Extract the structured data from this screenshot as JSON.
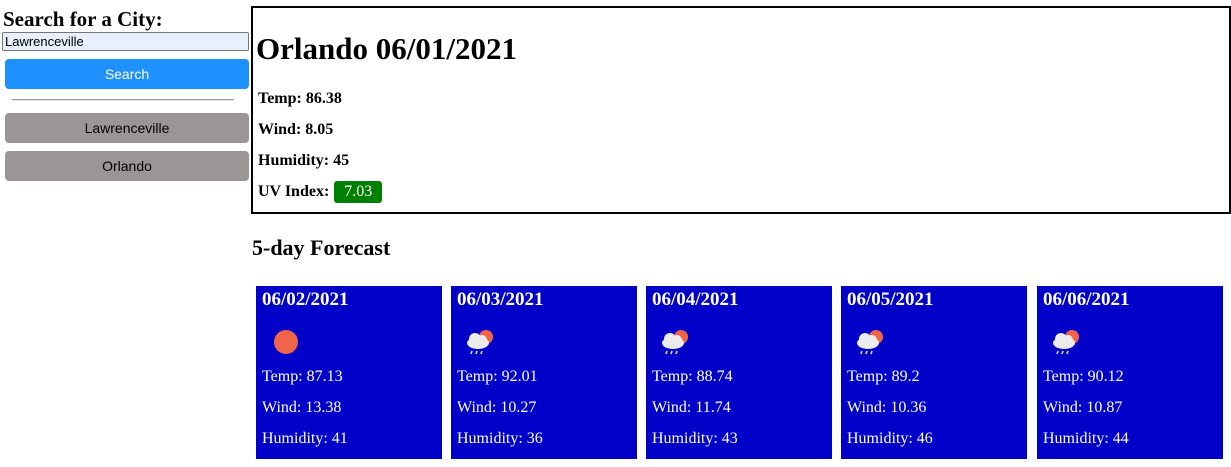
{
  "sidebar": {
    "heading": "Search for a City:",
    "input_value": "Lawrenceville",
    "search_label": "Search",
    "history": [
      "Lawrenceville",
      "Orlando"
    ]
  },
  "current": {
    "title": "Orlando 06/01/2021",
    "temp": "Temp: 86.38",
    "wind": "Wind: 8.05",
    "humidity": "Humidity: 45",
    "uv_label": "UV Index:",
    "uv_value": "7.03",
    "uv_color": "#008000"
  },
  "forecast": {
    "heading": "5-day Forecast",
    "card_color": "#0000c8",
    "days": [
      {
        "date": "06/02/2021",
        "icon": "sun-icon",
        "temp": "Temp: 87.13",
        "wind": "Wind: 13.38",
        "humidity": "Humidity: 41"
      },
      {
        "date": "06/03/2021",
        "icon": "rain-icon",
        "temp": "Temp: 92.01",
        "wind": "Wind: 10.27",
        "humidity": "Humidity: 36"
      },
      {
        "date": "06/04/2021",
        "icon": "rain-icon",
        "temp": "Temp: 88.74",
        "wind": "Wind: 11.74",
        "humidity": "Humidity: 43"
      },
      {
        "date": "06/05/2021",
        "icon": "rain-icon",
        "temp": "Temp: 89.2",
        "wind": "Wind: 10.36",
        "humidity": "Humidity: 46"
      },
      {
        "date": "06/06/2021",
        "icon": "rain-icon",
        "temp": "Temp: 90.12",
        "wind": "Wind: 10.87",
        "humidity": "Humidity: 44"
      }
    ]
  }
}
